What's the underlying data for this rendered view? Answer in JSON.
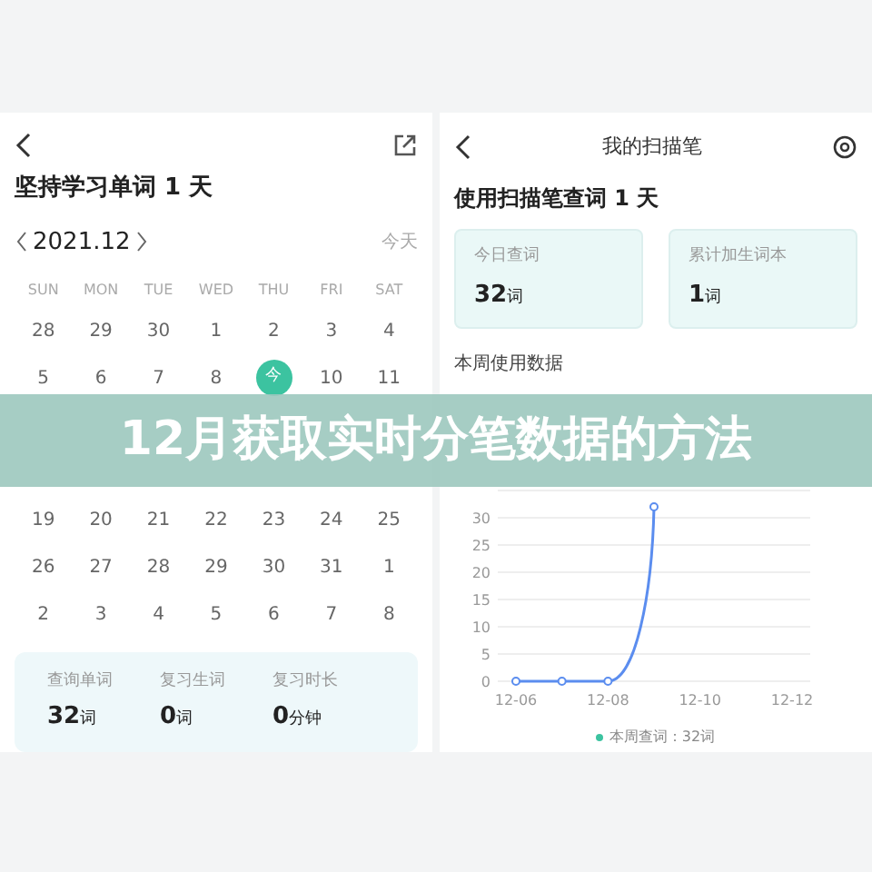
{
  "left_screen": {
    "title": "坚持学习单词 1 天",
    "month": "2021.12",
    "today_link": "今天",
    "weekdays": [
      "SUN",
      "MON",
      "TUE",
      "WED",
      "THU",
      "FRI",
      "SAT"
    ],
    "weeks": [
      [
        {
          "label": "28",
          "selected": false
        },
        {
          "label": "29",
          "selected": false
        },
        {
          "label": "30",
          "selected": false
        },
        {
          "label": "1",
          "selected": false
        },
        {
          "label": "2",
          "selected": false
        },
        {
          "label": "3",
          "selected": false
        },
        {
          "label": "4",
          "selected": false
        }
      ],
      [
        {
          "label": "5",
          "selected": false
        },
        {
          "label": "6",
          "selected": false
        },
        {
          "label": "7",
          "selected": false
        },
        {
          "label": "8",
          "selected": false
        },
        {
          "label": "今",
          "selected": true
        },
        {
          "label": "10",
          "selected": false
        },
        {
          "label": "11",
          "selected": false
        }
      ],
      [
        {
          "label": "19",
          "selected": false
        },
        {
          "label": "20",
          "selected": false
        },
        {
          "label": "21",
          "selected": false
        },
        {
          "label": "22",
          "selected": false
        },
        {
          "label": "23",
          "selected": false
        },
        {
          "label": "24",
          "selected": false
        },
        {
          "label": "25",
          "selected": false
        }
      ],
      [
        {
          "label": "26",
          "selected": false
        },
        {
          "label": "27",
          "selected": false
        },
        {
          "label": "28",
          "selected": false
        },
        {
          "label": "29",
          "selected": false
        },
        {
          "label": "30",
          "selected": false
        },
        {
          "label": "31",
          "selected": false
        },
        {
          "label": "1",
          "selected": false
        }
      ],
      [
        {
          "label": "2",
          "selected": false
        },
        {
          "label": "3",
          "selected": false
        },
        {
          "label": "4",
          "selected": false
        },
        {
          "label": "5",
          "selected": false
        },
        {
          "label": "6",
          "selected": false
        },
        {
          "label": "7",
          "selected": false
        },
        {
          "label": "8",
          "selected": false
        }
      ]
    ],
    "stats": [
      {
        "label": "查询单词",
        "value": "32",
        "unit": "词"
      },
      {
        "label": "复习生词",
        "value": "0",
        "unit": "词"
      },
      {
        "label": "复习时长",
        "value": "0",
        "unit": "分钟"
      }
    ]
  },
  "right_screen": {
    "title": "我的扫描笔",
    "heading": "使用扫描笔查词 1 天",
    "cards": [
      {
        "label": "今日查词",
        "value": "32",
        "unit": "词"
      },
      {
        "label": "累计加生词本",
        "value": "1",
        "unit": "词"
      }
    ],
    "section_title": "本周使用数据",
    "chart_data": {
      "type": "line",
      "categories": [
        "12-06",
        null,
        "12-08",
        null,
        "12-10",
        null,
        "12-12"
      ],
      "series": [
        {
          "name": "本周查词",
          "color": "#5b8def",
          "marker": "circle",
          "values": [
            0,
            0,
            0,
            32,
            null,
            null,
            null
          ]
        }
      ],
      "ylim": [
        0,
        35
      ],
      "yticks": [
        0,
        5,
        10,
        15,
        20,
        25,
        30
      ],
      "grid": true
    },
    "legend_value": "：32词"
  },
  "banner": "12月获取实时分笔数据的方法"
}
